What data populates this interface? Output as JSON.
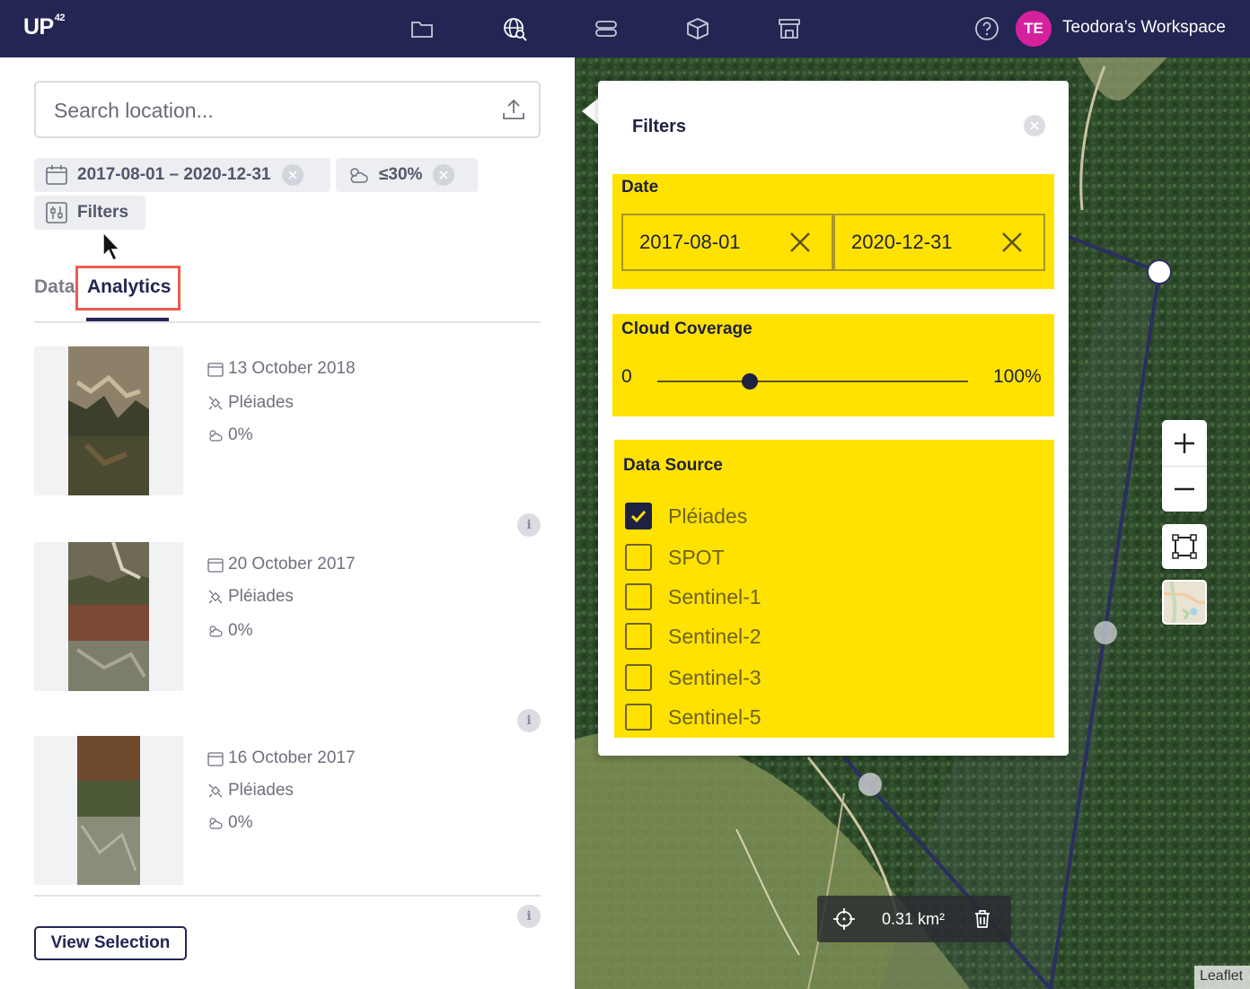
{
  "header": {
    "logo_text": "UP",
    "logo_sup": "42",
    "nav_icons": [
      "folder-icon",
      "globe-search-icon",
      "database-icon",
      "box-icon",
      "storefront-icon"
    ],
    "help_icon": "help-icon",
    "avatar_initials": "TE",
    "workspace_name": "Teodora’s Workspace",
    "avatar_color": "#d6219e",
    "bar_color": "#232653"
  },
  "search": {
    "placeholder": "Search location...",
    "value": "",
    "upload_icon": "upload-icon"
  },
  "chips": {
    "date_range": "2017-08-01 – 2020-12-31",
    "cloud": "≤30%",
    "filters": "Filters"
  },
  "tabs": {
    "data": "Data",
    "analytics": "Analytics"
  },
  "results": [
    {
      "date": "13 October 2018",
      "source": "Pléiades",
      "cloud": "0%",
      "info": "i"
    },
    {
      "date": "20 October 2017",
      "source": "Pléiades",
      "cloud": "0%",
      "info": "i"
    },
    {
      "date": "16 October 2017",
      "source": "Pléiades",
      "cloud": "0%",
      "info": "i"
    }
  ],
  "view_selection": "View Selection",
  "filters_panel": {
    "title": "Filters",
    "date": {
      "title": "Date",
      "start": "2017-08-01",
      "end": "2020-12-31"
    },
    "cloud": {
      "title": "Cloud Coverage",
      "min_label": "0",
      "max_label": "100%",
      "value_fraction": 0.3
    },
    "data_source": {
      "title": "Data Source",
      "options": [
        {
          "label": "Pléiades",
          "checked": true
        },
        {
          "label": "SPOT",
          "checked": false
        },
        {
          "label": "Sentinel-1",
          "checked": false
        },
        {
          "label": "Sentinel-2",
          "checked": false
        },
        {
          "label": "Sentinel-3",
          "checked": false
        },
        {
          "label": "Sentinel-5",
          "checked": false
        }
      ]
    },
    "highlight_color": "#ffe200"
  },
  "map": {
    "area": "0.31 km²",
    "attribution": "Leaflet"
  }
}
